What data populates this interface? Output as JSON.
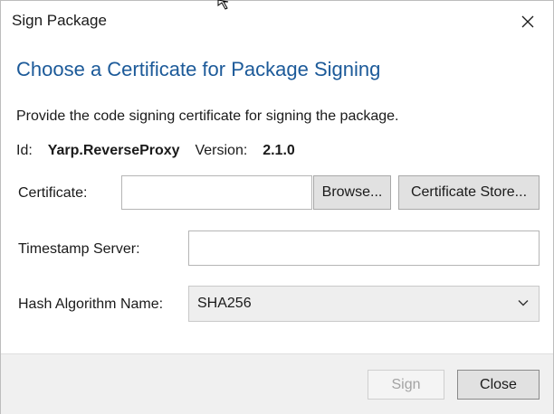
{
  "window": {
    "title": "Sign Package"
  },
  "main": {
    "heading": "Choose a Certificate for Package Signing",
    "description": "Provide the code signing certificate for signing the package.",
    "id_label": "Id:",
    "id_value": "Yarp.ReverseProxy",
    "version_label": "Version:",
    "version_value": "2.1.0"
  },
  "certificate": {
    "label": "Certificate:",
    "value": "",
    "browse_label": "Browse...",
    "store_label": "Certificate Store..."
  },
  "timestamp": {
    "label": "Timestamp Server:",
    "value": ""
  },
  "hash": {
    "label": "Hash Algorithm Name:",
    "selected": "SHA256"
  },
  "footer": {
    "sign_label": "Sign",
    "close_label": "Close"
  },
  "icons": {
    "close": "close-icon",
    "dropdown": "chevron-down-icon",
    "cursor": "mouse-cursor-icon"
  },
  "colors": {
    "heading": "#1c5a99",
    "footer_bg": "#f0f0f0"
  }
}
